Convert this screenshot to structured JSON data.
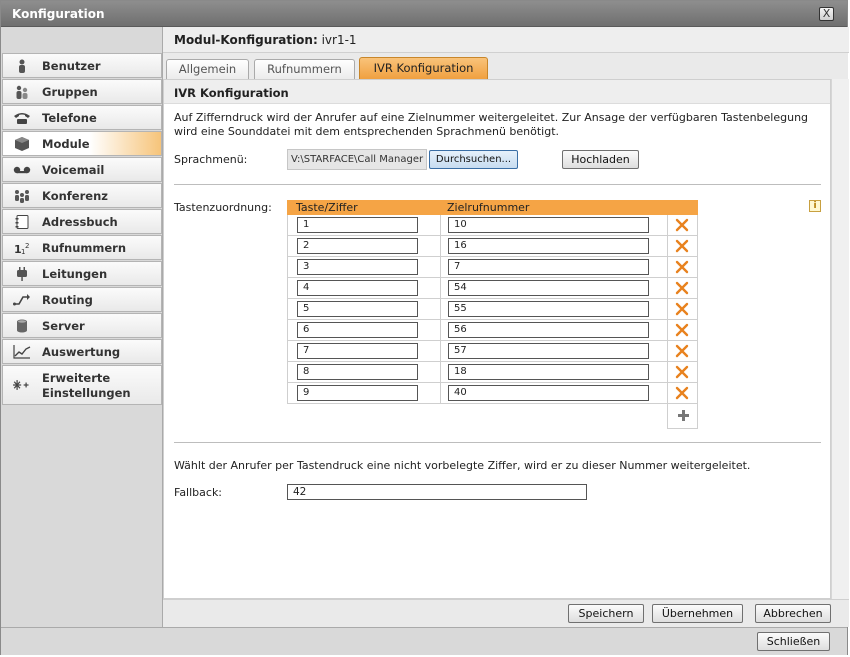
{
  "window": {
    "title": "Konfiguration",
    "close_label": "X"
  },
  "sidebar": {
    "items": [
      {
        "label": "Benutzer",
        "icon": "user-icon"
      },
      {
        "label": "Gruppen",
        "icon": "group-icon"
      },
      {
        "label": "Telefone",
        "icon": "phone-icon"
      },
      {
        "label": "Module",
        "icon": "module-icon",
        "active": true
      },
      {
        "label": "Voicemail",
        "icon": "voicemail-icon"
      },
      {
        "label": "Konferenz",
        "icon": "conference-icon"
      },
      {
        "label": "Adressbuch",
        "icon": "addressbook-icon"
      },
      {
        "label": "Rufnummern",
        "icon": "numbers-icon"
      },
      {
        "label": "Leitungen",
        "icon": "lines-icon"
      },
      {
        "label": "Routing",
        "icon": "routing-icon"
      },
      {
        "label": "Server",
        "icon": "server-icon"
      },
      {
        "label": "Auswertung",
        "icon": "chart-icon"
      },
      {
        "label": "Erweiterte Einstellungen",
        "icon": "advanced-settings-icon"
      }
    ]
  },
  "module_header": {
    "prefix": "Modul-Konfiguration:",
    "name": "ivr1-1"
  },
  "tabs": [
    {
      "label": "Allgemein"
    },
    {
      "label": "Rufnummern"
    },
    {
      "label": "IVR Konfiguration",
      "active": true
    }
  ],
  "section": {
    "title": "IVR Konfiguration",
    "description": "Auf Zifferndruck wird der Anrufer auf eine Zielnummer weitergeleitet. Zur Ansage der verfügbaren Tastenbelegung wird eine Sounddatei mit dem entsprechenden Sprachmenü benötigt."
  },
  "sprachmenu": {
    "label": "Sprachmenü:",
    "file_path": "V:\\STARFACE\\Call Manager",
    "browse_label": "Durchsuchen...",
    "upload_label": "Hochladen"
  },
  "mapping": {
    "label": "Tastenzuordnung:",
    "col_key": "Taste/Ziffer",
    "col_target": "Zielrufnummer",
    "rows": [
      {
        "key": "1",
        "target": "10"
      },
      {
        "key": "2",
        "target": "16"
      },
      {
        "key": "3",
        "target": "7"
      },
      {
        "key": "4",
        "target": "54"
      },
      {
        "key": "5",
        "target": "55"
      },
      {
        "key": "6",
        "target": "56"
      },
      {
        "key": "7",
        "target": "57"
      },
      {
        "key": "8",
        "target": "18"
      },
      {
        "key": "9",
        "target": "40"
      }
    ]
  },
  "fallback": {
    "description": "Wählt der Anrufer per Tastendruck eine nicht vorbelegte Ziffer, wird er zu dieser Nummer weitergeleitet.",
    "label": "Fallback:",
    "value": "42"
  },
  "footer": {
    "save_label": "Speichern",
    "apply_label": "Übernehmen",
    "cancel_label": "Abbrechen"
  },
  "bottom": {
    "close_label": "Schließen"
  },
  "colors": {
    "accent": "#f5a445",
    "delete": "#e8821e"
  }
}
